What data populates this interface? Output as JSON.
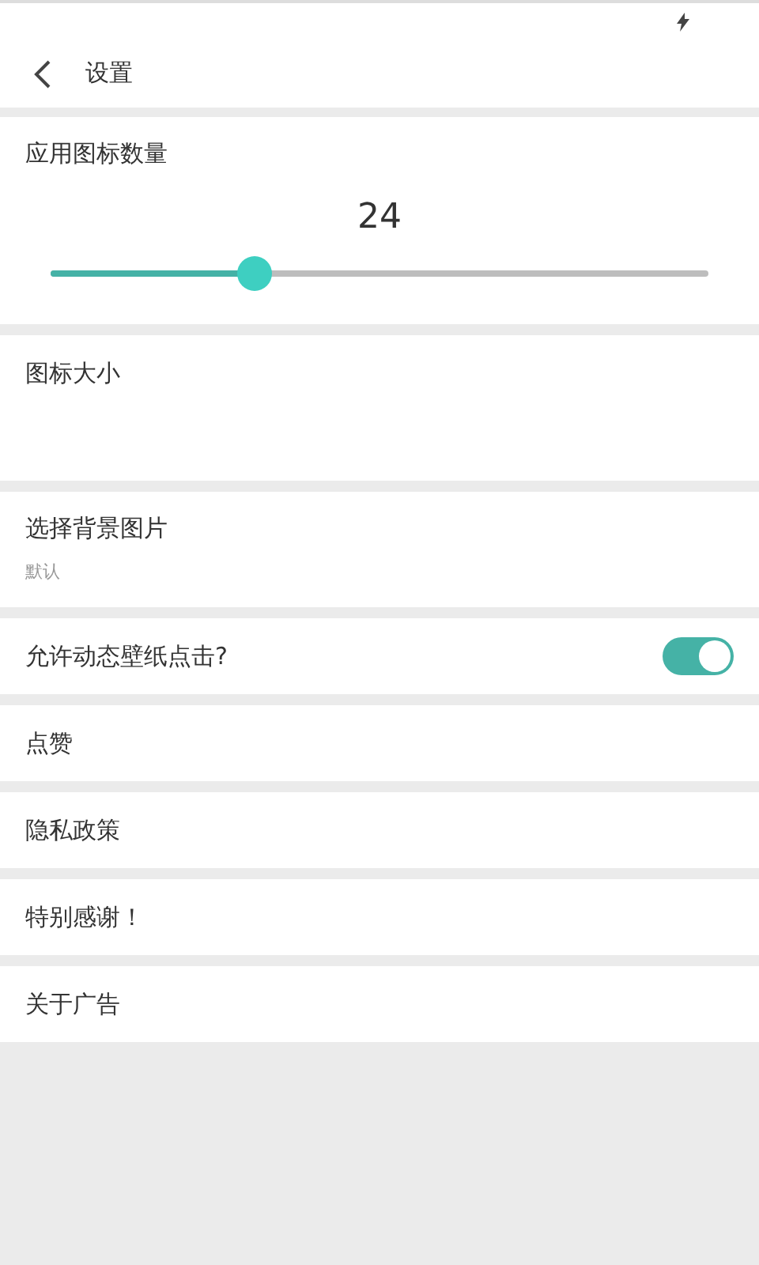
{
  "header": {
    "title": "设置"
  },
  "settings": [
    {
      "kind": "slider",
      "label": "应用图标数量",
      "reading": "24",
      "level": 0.31
    },
    {
      "kind": "blank",
      "label": "图标大小"
    },
    {
      "kind": "subtitle",
      "label": "选择背景图片",
      "subtitle": "默认"
    },
    {
      "kind": "toggle",
      "label": "允许动态壁纸点击?",
      "on": true
    },
    {
      "kind": "plain",
      "label": "点赞"
    },
    {
      "kind": "plain",
      "label": "隐私政策"
    },
    {
      "kind": "plain",
      "label": "特别感谢！"
    },
    {
      "kind": "plain",
      "label": "关于广告"
    }
  ]
}
